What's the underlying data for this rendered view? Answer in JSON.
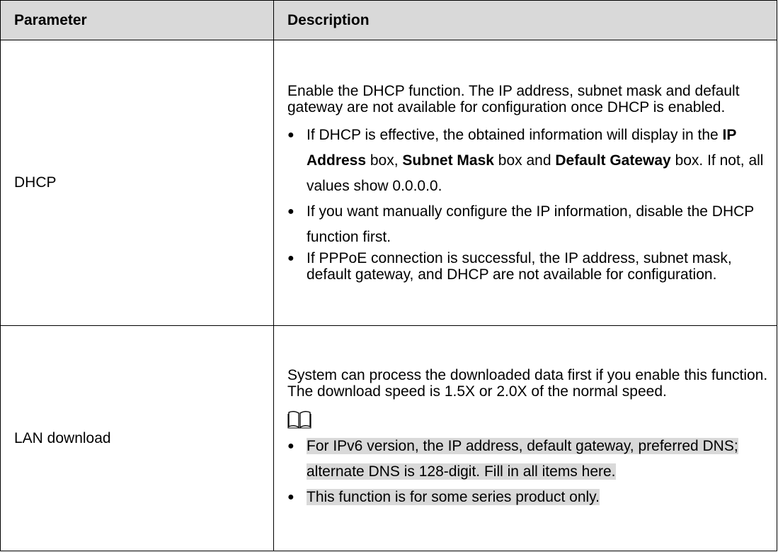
{
  "table": {
    "headers": {
      "parameter": "Parameter",
      "description": "Description"
    },
    "rows": [
      {
        "parameter": "DHCP",
        "intro": "Enable the DHCP function. The IP address, subnet mask and default gateway are not available for configuration once DHCP is enabled.",
        "bullet1": {
          "t1": "If DHCP is effective, the obtained information will display in the ",
          "b1": "IP Address",
          "t2": " box, ",
          "b2": "Subnet Mask",
          "t3": " box and ",
          "b3": "Default Gateway",
          "t4": " box. If not, all values show 0.0.0.0."
        },
        "bullet2": "If you want manually configure the IP information, disable the DHCP function first.",
        "bullet3": "If PPPoE connection is successful, the IP address, subnet mask, default gateway, and DHCP are not available for configuration."
      },
      {
        "parameter": "LAN download",
        "intro": "System can process the downloaded data first if you enable this function. The download speed is 1.5X or 2.0X of the normal speed.",
        "note_icon": "book-note-icon",
        "bullet1": "For IPv6 version, the IP address, default gateway, preferred DNS; alternate DNS is 128-digit. Fill in all items here.",
        "bullet2": "This function is for some series product only."
      }
    ]
  }
}
